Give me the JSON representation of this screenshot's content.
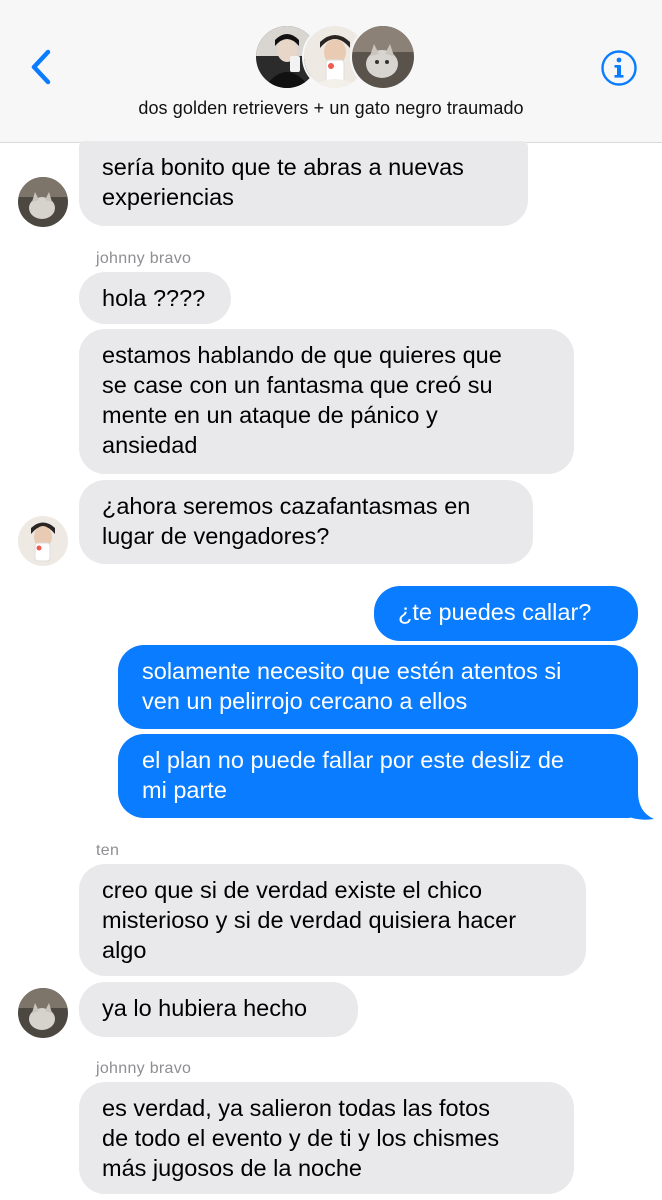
{
  "header": {
    "group_name": "dos golden retrievers + un gato negro traumado"
  },
  "messages": [
    {
      "lines": [
        "sería bonito que te abras a nuevas",
        "experiencias"
      ]
    },
    {
      "sender": "johnny bravo",
      "lines": [
        "hola ????"
      ]
    },
    {
      "lines": [
        "estamos hablando de que quieres que",
        "se case con un fantasma que creó su",
        "mente en un ataque de pánico y",
        "ansiedad"
      ]
    },
    {
      "lines": [
        "¿ahora seremos cazafantasmas en",
        "lugar de vengadores?"
      ]
    },
    {
      "lines": [
        "¿te puedes callar?"
      ]
    },
    {
      "lines": [
        "solamente necesito que estén atentos si",
        "ven un pelirrojo cercano a ellos"
      ]
    },
    {
      "lines": [
        "el plan no puede fallar por este desliz de",
        "mi parte"
      ]
    },
    {
      "sender": "ten",
      "lines": [
        "creo que si de verdad existe el chico",
        "misterioso y si de verdad quisiera hacer",
        "algo"
      ]
    },
    {
      "lines": [
        "ya lo hubiera hecho"
      ]
    },
    {
      "sender": "johnny bravo",
      "lines": [
        "es verdad, ya salieron todas las fotos",
        "de todo el evento y de ti y los chismes",
        "más jugosos de la noche"
      ]
    }
  ],
  "colors": {
    "accent_blue": "#0a7cff",
    "incoming_bubble": "#e9e9eb",
    "header_bg": "#f7f7f8"
  },
  "icons": {
    "back": "chevron-left-icon",
    "info": "info-circle-icon"
  }
}
